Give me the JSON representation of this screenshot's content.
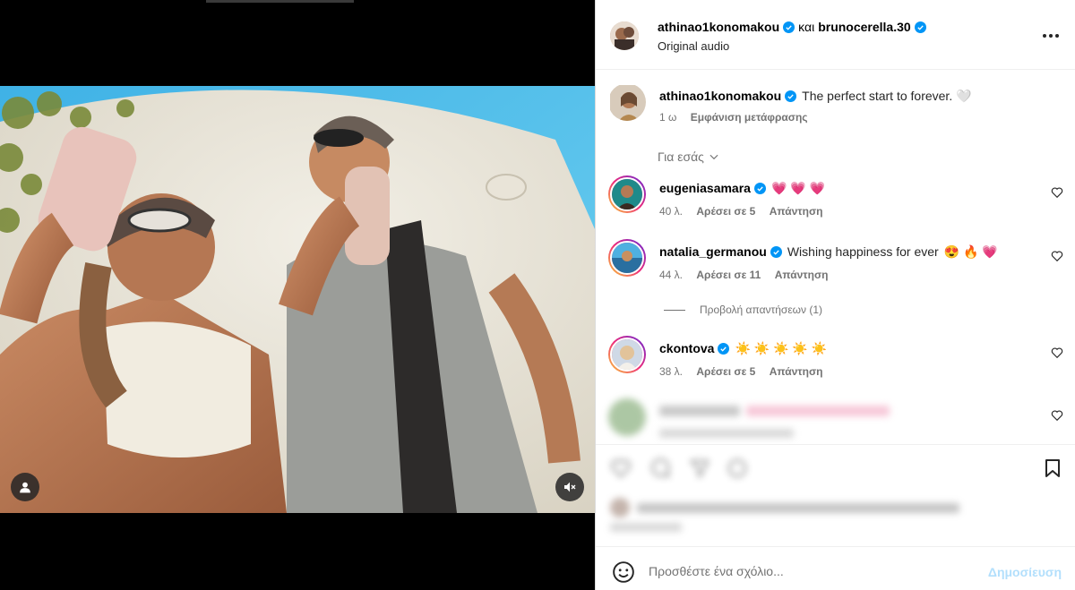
{
  "header": {
    "author": "athinao1konomakou",
    "conjunction": "και",
    "coauthor": "brunocerella.30",
    "audio": "Original audio"
  },
  "caption": {
    "username": "athinao1konomakou",
    "text": "The perfect start to forever.",
    "emoji": "🤍",
    "time": "1 ω",
    "translate": "Εμφάνιση μετάφρασης"
  },
  "for_you": "Για εσάς",
  "comments": [
    {
      "username": "eugeniasamara",
      "text": "",
      "emoji": "💗 💗 💗",
      "time": "40 λ.",
      "likes": "Αρέσει σε 5",
      "reply": "Απάντηση"
    },
    {
      "username": "natalia_germanou",
      "text": "Wishing happiness for ever",
      "emoji": "😍 🔥 💗",
      "time": "44 λ.",
      "likes": "Αρέσει σε 11",
      "reply": "Απάντηση",
      "view_replies": "Προβολή απαντήσεων (1)"
    },
    {
      "username": "ckontova",
      "text": "",
      "emoji": "☀️ ☀️ ☀️ ☀️ ☀️",
      "time": "38 λ.",
      "likes": "Αρέσει σε 5",
      "reply": "Απάντηση"
    }
  ],
  "add_comment": {
    "placeholder": "Προσθέστε ένα σχόλιο...",
    "post": "Δημοσίευση"
  },
  "icons": {
    "verified": "verified-badge-icon",
    "more": "more-options-icon",
    "heart": "heart-icon",
    "bookmark": "bookmark-icon",
    "smile": "emoji-smile-icon",
    "mute": "volume-muted-icon",
    "user_tag": "user-tag-icon"
  },
  "colors": {
    "verified": "#0095f6",
    "post_disabled": "#b2dffc",
    "secondary_text": "#737373"
  }
}
